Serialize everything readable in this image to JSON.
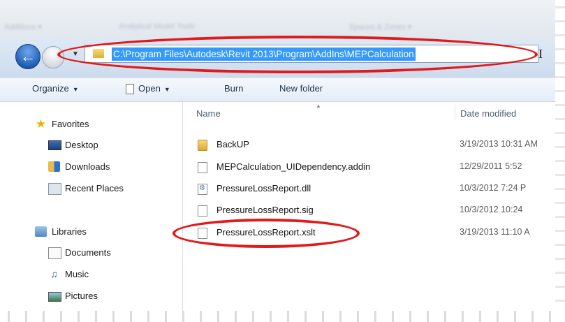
{
  "window": {
    "ribbon_fragments": [
      "Additions ▾",
      "Analytical Model Tools",
      "Spaces & Zones ▾"
    ],
    "address_bar": {
      "path": "C:\\Program Files\\Autodesk\\Revit 2013\\Program\\AddIns\\MEPCalculation"
    },
    "toolbar": {
      "organize_label": "Organize",
      "open_label": "Open",
      "burn_label": "Burn",
      "new_folder_label": "New folder"
    },
    "nav_pane": {
      "favorites": {
        "label": "Favorites",
        "items": [
          {
            "label": "Desktop",
            "icon": "desktop-icon"
          },
          {
            "label": "Downloads",
            "icon": "downloads-icon"
          },
          {
            "label": "Recent Places",
            "icon": "recent-places-icon"
          }
        ]
      },
      "libraries": {
        "label": "Libraries",
        "items": [
          {
            "label": "Documents",
            "icon": "documents-icon"
          },
          {
            "label": "Music",
            "icon": "music-icon"
          },
          {
            "label": "Pictures",
            "icon": "pictures-icon"
          }
        ]
      }
    },
    "file_list": {
      "columns": {
        "name": "Name",
        "date_modified": "Date modified"
      },
      "rows": [
        {
          "name": "BackUP",
          "date": "3/19/2013 10:31 AM",
          "icon": "folder-icon"
        },
        {
          "name": "MEPCalculation_UIDependency.addin",
          "date": "12/29/2011 5:52",
          "icon": "file-icon"
        },
        {
          "name": "PressureLossReport.dll",
          "date": "10/3/2012 7:24 P",
          "icon": "dll-icon"
        },
        {
          "name": "PressureLossReport.sig",
          "date": "10/3/2012 10:24",
          "icon": "file-icon"
        },
        {
          "name": "PressureLossReport.xslt",
          "date": "3/19/2013 11:10 A",
          "icon": "file-icon"
        }
      ]
    },
    "annotation_color": "#e11a1a"
  }
}
